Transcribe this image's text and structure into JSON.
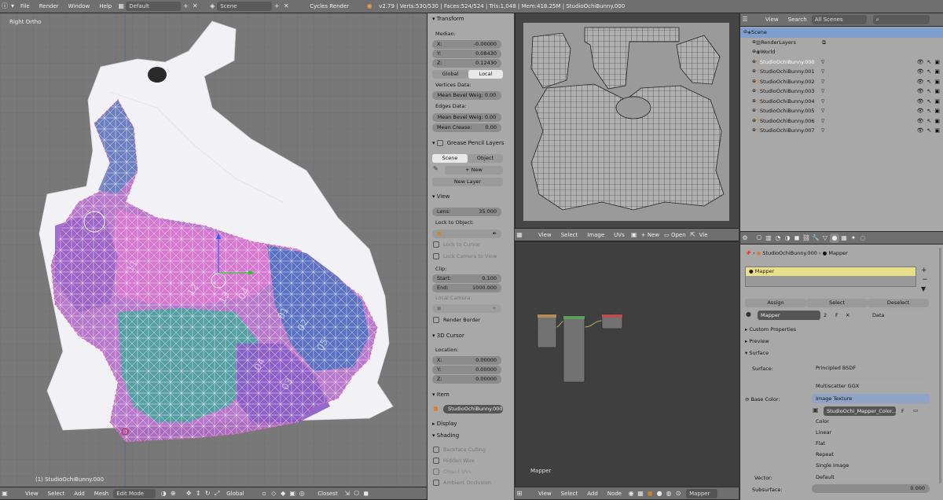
{
  "topbar": {
    "menus": [
      "File",
      "Render",
      "Window",
      "Help"
    ],
    "screen_layout": "Default",
    "scene": "Scene",
    "engine": "Cycles Render",
    "stats": "v2.79 | Verts:530/530 | Faces:524/524 | Tris:1,048 | Mem:418.25M | StudioOchiBunny.000"
  },
  "viewport": {
    "view_label": "Right Ortho",
    "object_label": "(1) StudioOchiBunny.000",
    "footer": {
      "menus": [
        "View",
        "Select",
        "Add",
        "Mesh"
      ],
      "mode": "Edit Mode",
      "orientation": "Global",
      "snap": "Closest"
    },
    "uv_islands": [
      "11",
      "12",
      "13",
      "04",
      "01",
      "02",
      "05",
      "04",
      "03"
    ]
  },
  "npanel": {
    "transform_title": "Transform",
    "median_label": "Median:",
    "median": [
      {
        "axis": "X:",
        "value": "-0.00000"
      },
      {
        "axis": "Y:",
        "value": "0.08430"
      },
      {
        "axis": "Z:",
        "value": "0.12430"
      }
    ],
    "global_label": "Global",
    "local_label": "Local",
    "vertices_data": "Vertices Data:",
    "mean_bevel_weight_v": "Mean Bevel Weig: 0.00",
    "edges_data": "Edges Data:",
    "mean_bevel_weight_e": "Mean Bevel Weig: 0.00",
    "mean_crease": "Mean Crease:",
    "mean_crease_value": "0.00",
    "gp_title": "Grease Pencil Layers",
    "gp_scene": "Scene",
    "gp_object": "Object",
    "gp_new": "New",
    "gp_new_layer": "New Layer",
    "view_title": "View",
    "lens_label": "Lens:",
    "lens_value": "35.000",
    "lock_to_object": "Lock to Object:",
    "lock_to_cursor": "Lock to Cursor",
    "lock_camera": "Lock Camera to View",
    "clip_label": "Clip:",
    "clip_start_label": "Start:",
    "clip_start": "0.100",
    "clip_end_label": "End:",
    "clip_end": "1000.000",
    "local_camera": "Local Camera:",
    "render_border": "Render Border",
    "cursor_title": "3D Cursor",
    "location_label": "Location:",
    "cursor": [
      {
        "axis": "X:",
        "value": "0.00000"
      },
      {
        "axis": "Y:",
        "value": "0.00000"
      },
      {
        "axis": "Z:",
        "value": "0.00000"
      }
    ],
    "item_title": "Item",
    "item_name": "StudioOchiBunny.000",
    "display_title": "Display",
    "shading_title": "Shading",
    "backface_culling": "Backface Culling",
    "hidden_wire": "Hidden Wire",
    "object_uvs": "Object UVs",
    "ambient_occlusion": "Ambient Occlusion"
  },
  "uv_editor": {
    "footer": [
      "View",
      "Select",
      "Image",
      "UVs"
    ],
    "new_label": "New",
    "open_label": "Open",
    "extra": "Vie"
  },
  "node_editor": {
    "label": "Mapper",
    "footer": [
      "View",
      "Select",
      "Add",
      "Node"
    ],
    "material": "Mapper"
  },
  "outliner": {
    "view": "View",
    "search": "Search",
    "filter": "All Scenes",
    "items": [
      {
        "name": "Scene",
        "indent": 0,
        "selected": true
      },
      {
        "name": "RenderLayers",
        "indent": 1
      },
      {
        "name": "World",
        "indent": 1
      },
      {
        "name": "StudioOchiBunny.000",
        "indent": 1,
        "active": true
      },
      {
        "name": "StudioOchiBunny.001",
        "indent": 1
      },
      {
        "name": "StudioOchiBunny.002",
        "indent": 1
      },
      {
        "name": "StudioOchiBunny.003",
        "indent": 1
      },
      {
        "name": "StudioOchiBunny.004",
        "indent": 1
      },
      {
        "name": "StudioOchiBunny.005",
        "indent": 1
      },
      {
        "name": "StudioOchiBunny.006",
        "indent": 1
      },
      {
        "name": "StudioOchiBunny.007",
        "indent": 1
      }
    ]
  },
  "properties": {
    "breadcrumb_object": "StudioOchiBunny.000",
    "breadcrumb_material": "Mapper",
    "slot_name": "Mapper",
    "assign": "Assign",
    "select": "Select",
    "deselect": "Deselect",
    "material_name": "Mapper",
    "users": "2",
    "fake": "F",
    "link": "Data",
    "custom_properties": "Custom Properties",
    "preview": "Preview",
    "surface": "Surface",
    "surface_label": "Surface:",
    "surface_value": "Principled BSDF",
    "distribution": "Multiscatter GGX",
    "base_color_label": "Base Color:",
    "base_color_value": "Image Texture",
    "image_name": "StudioOchi_Mapper_Color...",
    "image_fake": "F",
    "color": "Color",
    "interp": "Linear",
    "projection": "Flat",
    "extension": "Repeat",
    "source": "Single Image",
    "vector_label": "Vector:",
    "vector_value": "Default",
    "subsurface_label": "Subsurface:",
    "subsurface_value": "0.000"
  },
  "colors": {
    "header": "#6f6f6f",
    "panel": "#a8a8a8",
    "viewport": "#787878",
    "highlight": "#e8e08a"
  }
}
